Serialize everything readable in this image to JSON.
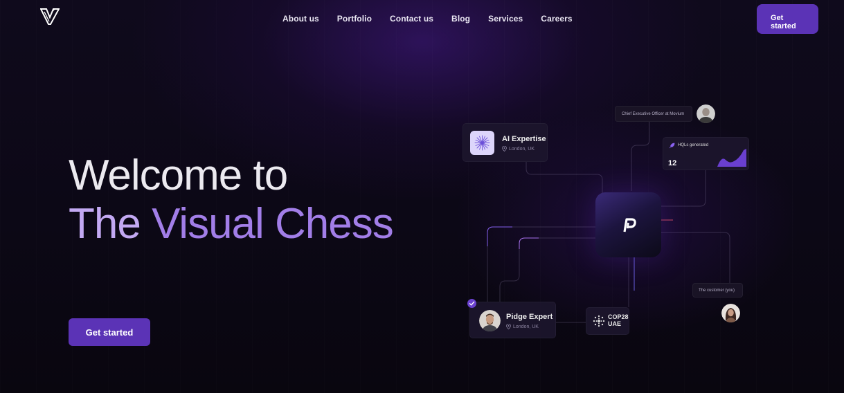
{
  "nav": {
    "items": [
      {
        "label": "About us"
      },
      {
        "label": "Portfolio"
      },
      {
        "label": "Contact us"
      },
      {
        "label": "Blog"
      },
      {
        "label": "Services"
      },
      {
        "label": "Careers"
      }
    ],
    "cta_label": "Get started"
  },
  "hero": {
    "line1": "Welcome to",
    "line2_part1": "The ",
    "line2_part2": "Visual Chess",
    "cta_label": "Get started"
  },
  "diagram": {
    "ai_card": {
      "title": "AI Expertise",
      "location": "London, UK"
    },
    "ceo": {
      "label": "Chief Executive Officer at Movium"
    },
    "hql": {
      "label": "HQLs generated",
      "value": "12"
    },
    "customer": {
      "label": "The customer (you)"
    },
    "expert_card": {
      "title": "Pidge Expert",
      "location": "London, UK"
    },
    "cop": {
      "line1": "COP28",
      "line2": "UAE"
    }
  },
  "colors": {
    "accent": "#5b33b6",
    "background": "#0b0712",
    "headline_accent": "#a27ee8",
    "headline_light": "#c3a9f3"
  },
  "icons": [
    "brand-logo-icon",
    "sparkle-icon",
    "location-pin-icon",
    "rocket-icon",
    "pidge-logo-icon",
    "check-icon",
    "globe-icon"
  ]
}
